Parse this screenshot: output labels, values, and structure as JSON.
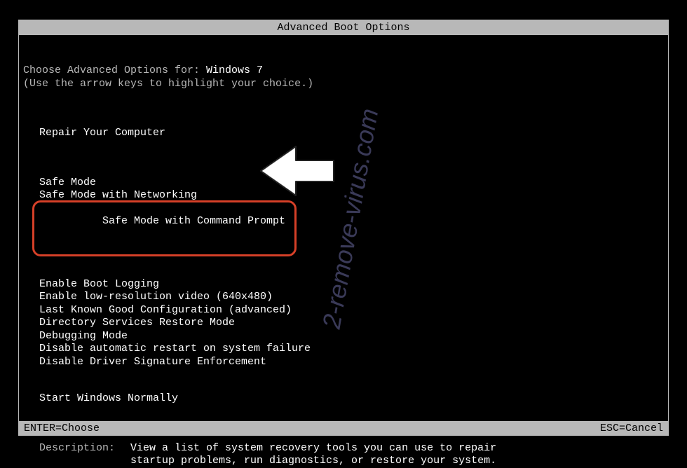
{
  "title": "Advanced Boot Options",
  "instruction1_prefix": "Choose Advanced Options for: ",
  "os_name": "Windows 7",
  "instruction2": "(Use the arrow keys to highlight your choice.)",
  "repair": "Repair Your Computer",
  "menu_block1": {
    "item0": "Safe Mode",
    "item1": "Safe Mode with Networking",
    "item2": "Safe Mode with Command Prompt"
  },
  "menu_block2": {
    "item0": "Enable Boot Logging",
    "item1": "Enable low-resolution video (640x480)",
    "item2": "Last Known Good Configuration (advanced)",
    "item3": "Directory Services Restore Mode",
    "item4": "Debugging Mode",
    "item5": "Disable automatic restart on system failure",
    "item6": "Disable Driver Signature Enforcement"
  },
  "menu_block3": {
    "item0": "Start Windows Normally"
  },
  "description": {
    "label": "Description:",
    "text": "View a list of system recovery tools you can use to repair startup problems, run diagnostics, or restore your system."
  },
  "footer": {
    "left": "ENTER=Choose",
    "right": "ESC=Cancel"
  },
  "watermark": "2-remove-virus.com"
}
